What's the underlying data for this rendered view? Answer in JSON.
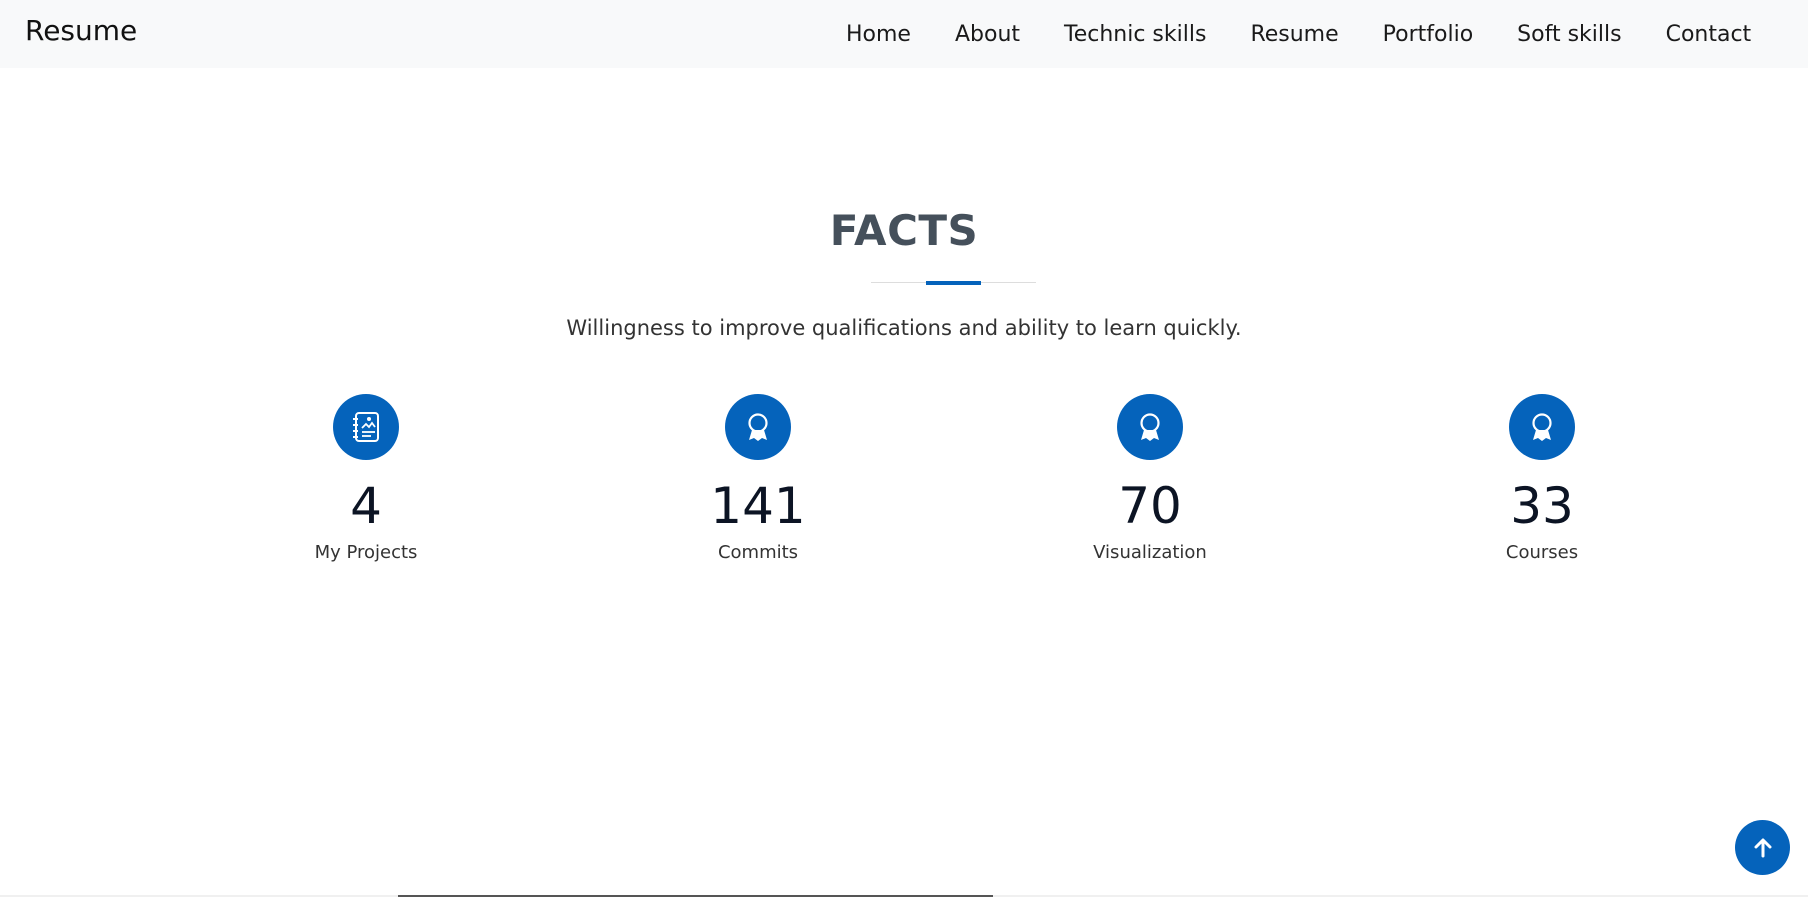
{
  "navbar": {
    "brand": "Resume",
    "links": [
      {
        "label": "Home"
      },
      {
        "label": "About"
      },
      {
        "label": "Technic skills"
      },
      {
        "label": "Resume"
      },
      {
        "label": "Portfolio"
      },
      {
        "label": "Soft skills"
      },
      {
        "label": "Contact"
      }
    ]
  },
  "facts": {
    "title": "FACTS",
    "subtitle": "Willingness to improve qualifications and ability to learn quickly.",
    "items": [
      {
        "icon": "journal-richtext-icon",
        "number": "4",
        "label": "My Projects"
      },
      {
        "icon": "award-icon",
        "number": "141",
        "label": "Commits"
      },
      {
        "icon": "award-icon",
        "number": "70",
        "label": "Visualization"
      },
      {
        "icon": "award-icon",
        "number": "33",
        "label": "Courses"
      }
    ]
  },
  "back_to_top": {
    "icon": "arrow-up-icon"
  },
  "colors": {
    "accent": "#0563bb",
    "navbar_bg": "#f8f9fa",
    "title": "#45505b",
    "number": "#0c1424"
  }
}
